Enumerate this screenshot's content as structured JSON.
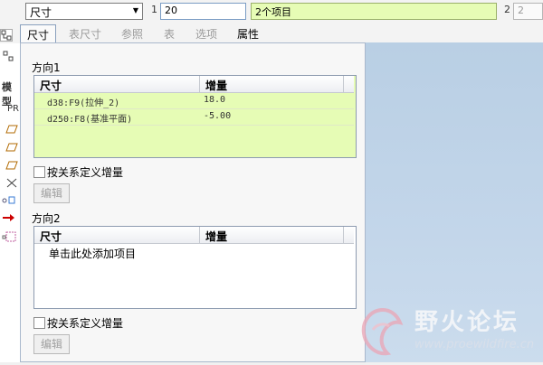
{
  "toolbar": {
    "type_select": "尺寸",
    "label1": "1",
    "value1": "20",
    "items_collected": "2个项目",
    "label2": "2",
    "value2": "2"
  },
  "tabs": [
    {
      "label": "尺寸",
      "active": true
    },
    {
      "label": "表尺寸",
      "active": false
    },
    {
      "label": "参照",
      "active": false
    },
    {
      "label": "表",
      "active": false
    },
    {
      "label": "选项",
      "active": false
    },
    {
      "label": "属性",
      "active": false
    }
  ],
  "tree": {
    "title": "模型",
    "root": "PR"
  },
  "direction1": {
    "label": "方向1",
    "columns": [
      "尺寸",
      "增量"
    ],
    "rows": [
      {
        "dim": "d38:F9(拉伸_2)",
        "inc": "18.0"
      },
      {
        "dim": "d250:F8(基准平面)",
        "inc": "-5.00"
      }
    ],
    "relation_label": "按关系定义增量",
    "edit_label": "编辑"
  },
  "direction2": {
    "label": "方向2",
    "columns": [
      "尺寸",
      "增量"
    ],
    "placeholder": "单击此处添加项目",
    "relation_label": "按关系定义增量",
    "edit_label": "编辑"
  },
  "watermark": {
    "title": "野火论坛",
    "url": "www.proewildfire.cn"
  },
  "colors": {
    "collect_green": "#e6fcb5",
    "tab_border": "#8aa0bd",
    "canvas_blue": "#c3d6ea"
  }
}
